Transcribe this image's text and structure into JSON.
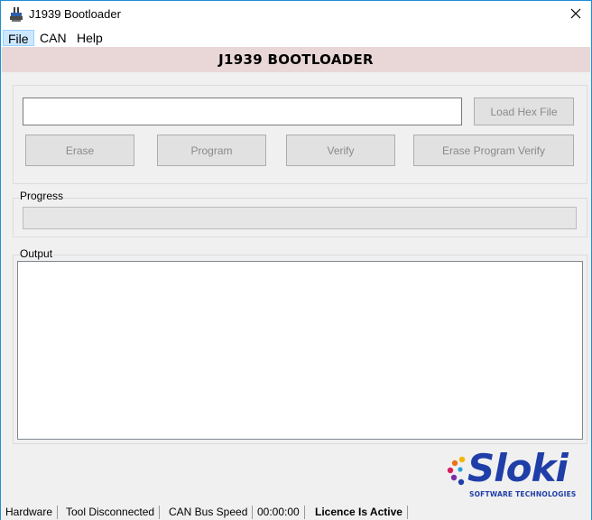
{
  "window": {
    "title": "J1939 Bootloader",
    "app_icon": "bootloader-app-icon",
    "close_icon": "close-icon"
  },
  "menu": {
    "items": [
      "File",
      "CAN",
      "Help"
    ],
    "active": "File"
  },
  "banner": {
    "title": "J1939 BOOTLOADER",
    "background": "#e9d7d7"
  },
  "file_section": {
    "hex_path_value": "",
    "load_button": "Load Hex File",
    "buttons_enabled": false
  },
  "actions": {
    "erase": "Erase",
    "program": "Program",
    "verify": "Verify",
    "erase_program_verify": "Erase Program Verify"
  },
  "progress": {
    "label": "Progress",
    "value_percent": 0
  },
  "output": {
    "label": "Output",
    "text": ""
  },
  "logo": {
    "name": "Sloki",
    "subtitle": "SOFTWARE TECHNOLOGIES",
    "color": "#1f3ea8"
  },
  "status_bar": {
    "hardware": "Hardware",
    "tool_status": "Tool Disconnected",
    "can_bus_speed": "CAN Bus Speed",
    "elapsed": "00:00:00",
    "licence": "Licence Is Active"
  }
}
